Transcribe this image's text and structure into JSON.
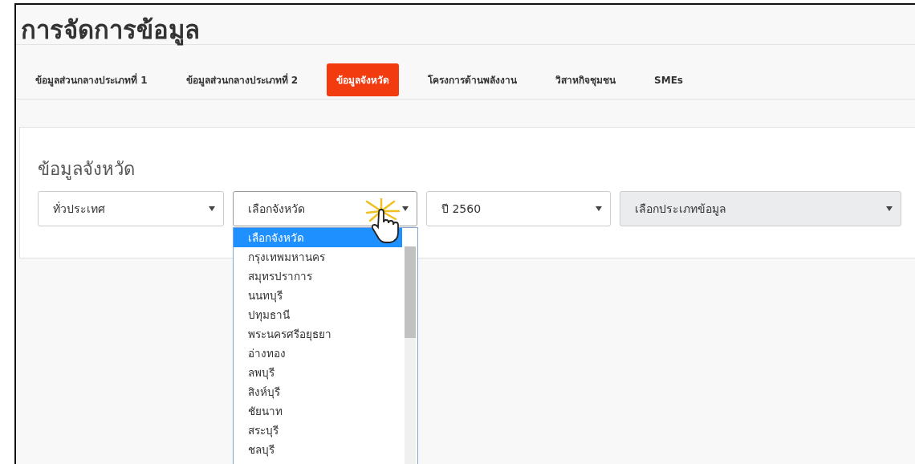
{
  "page_title": "การจัดการข้อมูล",
  "tabs": [
    {
      "label": "ข้อมูลส่วนกลางประเภทที่ 1",
      "selected": false
    },
    {
      "label": "ข้อมูลส่วนกลางประเภทที่ 2",
      "selected": false
    },
    {
      "label": "ข้อมูลจังหวัด",
      "selected": true
    },
    {
      "label": "โครงการด้านพลังงาน",
      "selected": false
    },
    {
      "label": "วิสาหกิจชุมชน",
      "selected": false
    },
    {
      "label": "SMEs",
      "selected": false
    }
  ],
  "card": {
    "title": "ข้อมูลจังหวัด",
    "selects": [
      {
        "value": "ทั่วประเทศ",
        "disabled": false,
        "open": false
      },
      {
        "value": "เลือกจังหวัด",
        "disabled": false,
        "open": true
      },
      {
        "value": "ปี 2560",
        "disabled": false,
        "open": false
      },
      {
        "value": "เลือกประเภทข้อมูล",
        "disabled": true,
        "open": false
      }
    ]
  },
  "dropdown_options": [
    {
      "label": "เลือกจังหวัด",
      "selected": true
    },
    {
      "label": "กรุงเทพมหานคร",
      "selected": false
    },
    {
      "label": "สมุทรปราการ",
      "selected": false
    },
    {
      "label": "นนทบุรี",
      "selected": false
    },
    {
      "label": "ปทุมธานี",
      "selected": false
    },
    {
      "label": "พระนครศรีอยุธยา",
      "selected": false
    },
    {
      "label": "อ่างทอง",
      "selected": false
    },
    {
      "label": "ลพบุรี",
      "selected": false
    },
    {
      "label": "สิงห์บุรี",
      "selected": false
    },
    {
      "label": "ชัยนาท",
      "selected": false
    },
    {
      "label": "สระบุรี",
      "selected": false
    },
    {
      "label": "ชลบุรี",
      "selected": false
    }
  ]
}
